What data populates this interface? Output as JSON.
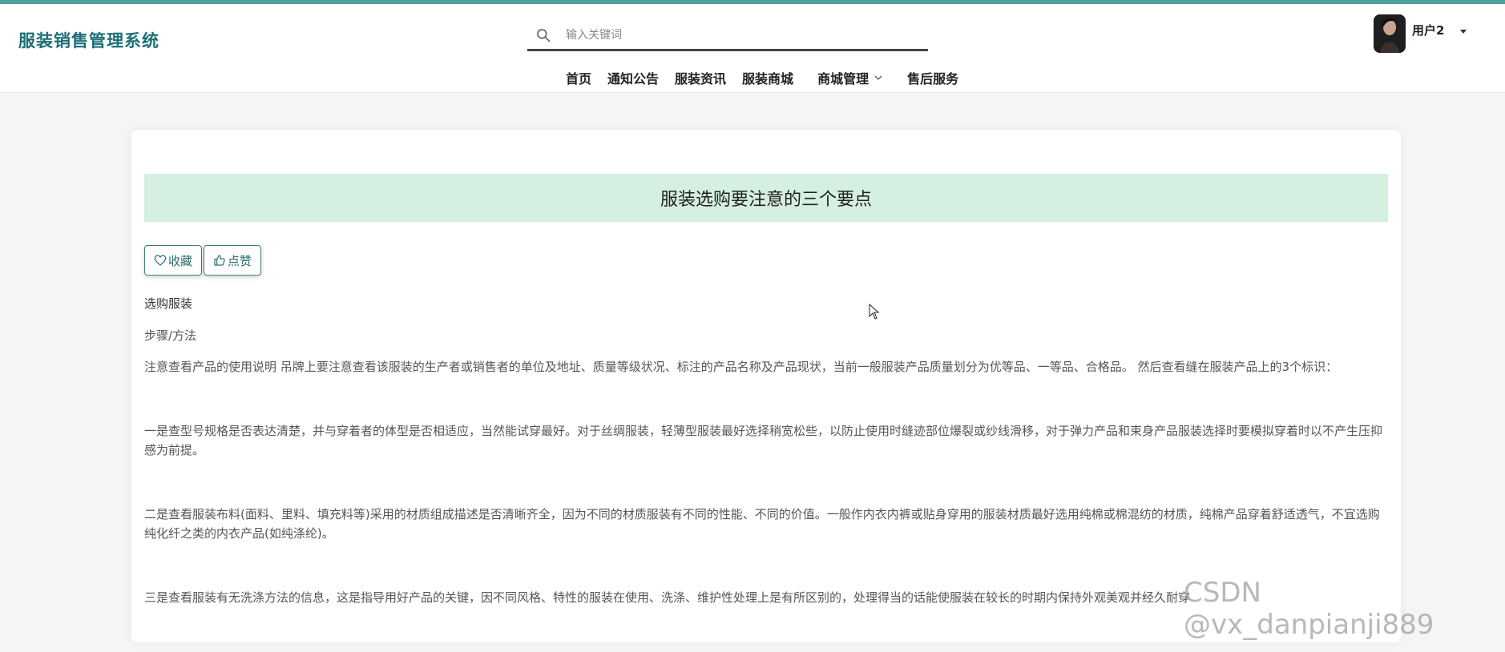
{
  "header": {
    "brand": "服装销售管理系统",
    "search_placeholder": "输入关键词",
    "user_name": "用户2"
  },
  "nav": {
    "items": [
      "首页",
      "通知公告",
      "服装资讯",
      "服装商城",
      "商城管理",
      "售后服务"
    ]
  },
  "article": {
    "title": "服装选购要注意的三个要点",
    "collect_label": "收藏",
    "like_label": "点赞",
    "heading": "选购服装",
    "subheading": "步骤/方法",
    "paragraphs": [
      "注意查看产品的使用说明 吊牌上要注意查看该服装的生产者或销售者的单位及地址、质量等级状况、标注的产品名称及产品现状，当前一般服装产品质量划分为优等品、一等品、合格品。 然后查看缝在服装产品上的3个标识：",
      "一是查型号规格是否表达清楚，并与穿着者的体型是否相适应，当然能试穿最好。对于丝绸服装，轻薄型服装最好选择稍宽松些，以防止使用时缝迹部位爆裂或纱线滑移，对于弹力产品和束身产品服装选择时要模拟穿着时以不产生压抑感为前提。",
      "二是查看服装布料(面料、里料、填充料等)采用的材质组成描述是否清晰齐全，因为不同的材质服装有不同的性能、不同的价值。一般作内衣内裤或贴身穿用的服装材质最好选用纯棉或棉混纺的材质，纯棉产品穿着舒适透气，不宜选购纯化纤之类的内衣产品(如纯涤纶)。",
      "三是查看服装有无洗涤方法的信息，这是指导用好产品的关键，因不同风格、特性的服装在使用、洗涤、维护性处理上是有所区别的，处理得当的话能使服装在较长的时期内保持外观美观并经久耐穿"
    ]
  },
  "watermark": "CSDN @vx_danpianji889",
  "colors": {
    "brand": "#1d6f79",
    "accent_line": "#47a39a",
    "title_bg": "#d5efe1",
    "button_border": "#3f7d7d"
  }
}
